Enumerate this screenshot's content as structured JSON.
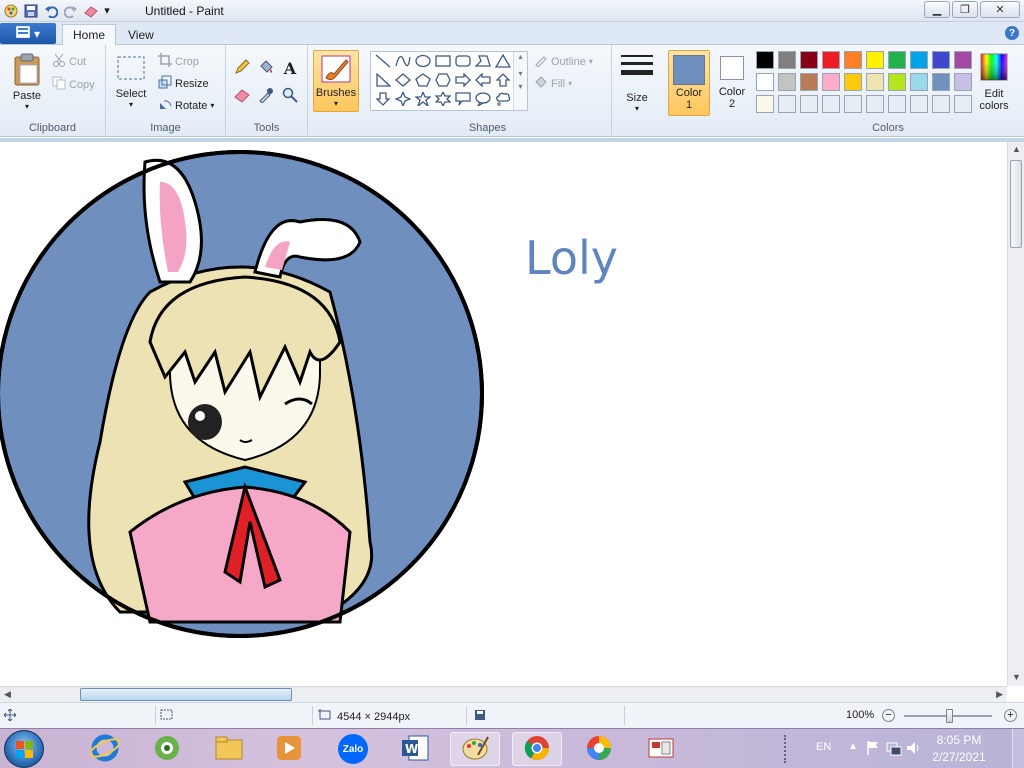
{
  "window": {
    "title": "Untitled - Paint"
  },
  "tabs": {
    "file_menu": "",
    "home": "Home",
    "view": "View"
  },
  "ribbon": {
    "clipboard": {
      "label": "Clipboard",
      "paste": "Paste",
      "cut": "Cut",
      "copy": "Copy"
    },
    "image": {
      "label": "Image",
      "select": "Select",
      "crop": "Crop",
      "resize": "Resize",
      "rotate": "Rotate"
    },
    "tools": {
      "label": "Tools",
      "text_tool": "A"
    },
    "brushes": {
      "label": "Brushes"
    },
    "shapes": {
      "label": "Shapes",
      "outline": "Outline",
      "fill": "Fill"
    },
    "size": {
      "label": "Size"
    },
    "color1": {
      "label": "Color",
      "num": "1",
      "value": "#6f8fbf"
    },
    "color2": {
      "label": "Color",
      "num": "2",
      "value": "#ffffff"
    },
    "colors": {
      "label": "Colors",
      "edit": "Edit",
      "edit2": "colors"
    },
    "palette_row1": [
      "#000000",
      "#7f7f7f",
      "#880015",
      "#ed1c24",
      "#ff7f27",
      "#fff200",
      "#22b14c",
      "#00a2e8",
      "#3f48cc",
      "#a349a4"
    ],
    "palette_row2": [
      "#ffffff",
      "#c3c3c3",
      "#b97a57",
      "#ffaec9",
      "#ffc90e",
      "#efe4b0",
      "#b5e61d",
      "#99d9ea",
      "#7092be",
      "#c8bfe7"
    ],
    "palette_row3": [
      "#fdf8ec",
      "#e7edf5",
      "#e7edf5",
      "#e7edf5",
      "#e7edf5",
      "#e7edf5",
      "#e7edf5",
      "#e7edf5",
      "#e7edf5",
      "#e7edf5"
    ]
  },
  "canvas": {
    "drawn_text": "Loly"
  },
  "status": {
    "dimensions": "4544 × 2944px",
    "zoom": "100%"
  },
  "taskbar": {
    "apps": [
      "Internet Explorer",
      "Cốc Cốc",
      "File Explorer",
      "Media Player",
      "Zalo",
      "Word",
      "Paint",
      "Chrome",
      "Color App",
      "Screenshot Tool"
    ],
    "zalo_label": "Zalo",
    "lang": "EN",
    "time": "8:05 PM",
    "date": "2/27/2021"
  }
}
